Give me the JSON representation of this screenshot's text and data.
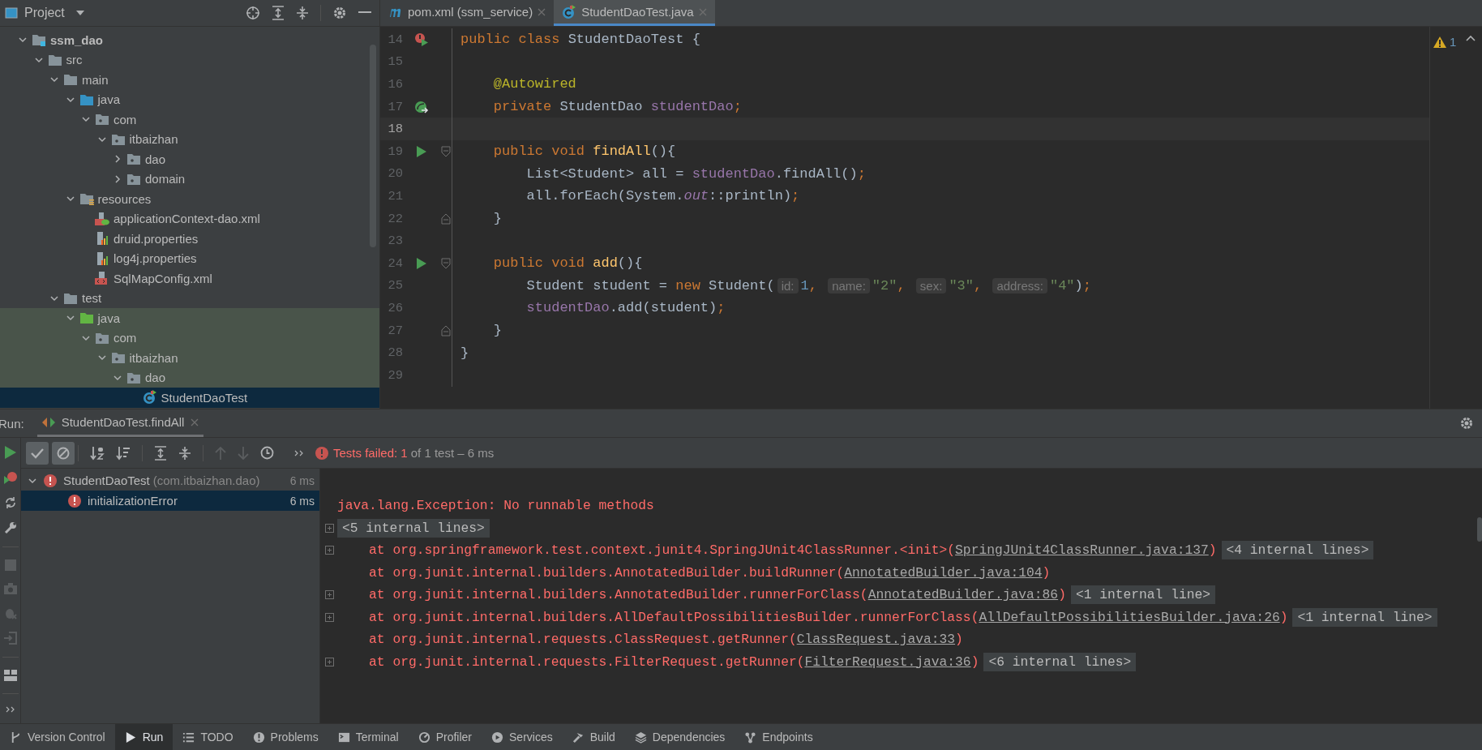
{
  "project": {
    "title": "Project",
    "tree": [
      {
        "label": "ssm_dao",
        "kind": "module",
        "expanded": true,
        "selected": false,
        "children": [
          {
            "label": "src",
            "kind": "folder",
            "expanded": true,
            "selected": false,
            "children": [
              {
                "label": "main",
                "kind": "folder",
                "expanded": true,
                "selected": false,
                "children": [
                  {
                    "label": "java",
                    "kind": "source",
                    "expanded": true,
                    "selected": false,
                    "children": [
                      {
                        "label": "com",
                        "kind": "package",
                        "expanded": true,
                        "selected": false,
                        "children": [
                          {
                            "label": "itbaizhan",
                            "kind": "package",
                            "expanded": true,
                            "selected": false,
                            "children": [
                              {
                                "label": "dao",
                                "kind": "package",
                                "expanded": false,
                                "selected": false
                              },
                              {
                                "label": "domain",
                                "kind": "package",
                                "expanded": false,
                                "selected": false
                              }
                            ]
                          }
                        ]
                      }
                    ]
                  },
                  {
                    "label": "resources",
                    "kind": "resources",
                    "expanded": true,
                    "selected": false,
                    "children": [
                      {
                        "label": "applicationContext-dao.xml",
                        "kind": "spring-xml",
                        "selected": false
                      },
                      {
                        "label": "druid.properties",
                        "kind": "properties",
                        "selected": false
                      },
                      {
                        "label": "log4j.properties",
                        "kind": "properties",
                        "selected": false
                      },
                      {
                        "label": "SqlMapConfig.xml",
                        "kind": "xml",
                        "selected": false
                      }
                    ]
                  }
                ]
              },
              {
                "label": "test",
                "kind": "folder",
                "expanded": true,
                "selected": false,
                "children": [
                  {
                    "label": "java",
                    "kind": "test-source",
                    "expanded": true,
                    "selected": false,
                    "children": [
                      {
                        "label": "com",
                        "kind": "package",
                        "expanded": true,
                        "selected": false,
                        "children": [
                          {
                            "label": "itbaizhan",
                            "kind": "package",
                            "expanded": true,
                            "selected": false,
                            "children": [
                              {
                                "label": "dao",
                                "kind": "package",
                                "expanded": true,
                                "selected": false,
                                "children": [
                                  {
                                    "label": "StudentDaoTest",
                                    "kind": "test-class",
                                    "selected": true
                                  }
                                ]
                              }
                            ]
                          }
                        ]
                      }
                    ]
                  }
                ]
              }
            ]
          }
        ]
      }
    ]
  },
  "editor": {
    "tabs": [
      {
        "label": "pom.xml (ssm_service)",
        "kind": "maven",
        "selected": false
      },
      {
        "label": "StudentDaoTest.java",
        "kind": "test-class",
        "selected": true
      }
    ],
    "warnings": "1",
    "lines": [
      {
        "number": "14",
        "current": false,
        "gutter": [
          {
            "kind": "class-run"
          }
        ],
        "tokens": [
          {
            "kind": "keyword",
            "text": "public class "
          },
          {
            "kind": "plain",
            "text": "StudentDaoTest {"
          }
        ]
      },
      {
        "number": "15",
        "current": false
      },
      {
        "number": "16",
        "current": false,
        "tokens": [
          {
            "kind": "annotation",
            "text": "    @Autowired"
          }
        ]
      },
      {
        "number": "17",
        "current": false,
        "gutter": [
          {
            "kind": "autowired"
          }
        ],
        "tokens": [
          {
            "kind": "keyword",
            "text": "    private "
          },
          {
            "kind": "plain",
            "text": "StudentDao "
          },
          {
            "kind": "field",
            "text": "studentDao"
          },
          {
            "kind": "keyword",
            "text": ";"
          }
        ]
      },
      {
        "number": "18",
        "current": true
      },
      {
        "number": "19",
        "current": false,
        "gutter": [
          {
            "kind": "run"
          },
          {
            "kind": "fold-start"
          }
        ],
        "tokens": [
          {
            "kind": "keyword",
            "text": "    public void "
          },
          {
            "kind": "method",
            "text": "findAll"
          },
          {
            "kind": "plain",
            "text": "(){"
          }
        ]
      },
      {
        "number": "20",
        "current": false,
        "tokens": [
          {
            "kind": "plain",
            "text": "        List<Student> all = "
          },
          {
            "kind": "field",
            "text": "studentDao"
          },
          {
            "kind": "plain",
            "text": ".findAll()"
          },
          {
            "kind": "keyword",
            "text": ";"
          }
        ]
      },
      {
        "number": "21",
        "current": false,
        "tokens": [
          {
            "kind": "plain",
            "text": "        all.forEach(System."
          },
          {
            "kind": "static",
            "text": "out"
          },
          {
            "kind": "plain",
            "text": "::println)"
          },
          {
            "kind": "keyword",
            "text": ";"
          }
        ]
      },
      {
        "number": "22",
        "current": false,
        "gutter": [
          {
            "kind": "fold-end"
          }
        ],
        "tokens": [
          {
            "kind": "plain",
            "text": "    }"
          }
        ]
      },
      {
        "number": "23",
        "current": false
      },
      {
        "number": "24",
        "current": false,
        "gutter": [
          {
            "kind": "run"
          },
          {
            "kind": "fold-start"
          }
        ],
        "tokens": [
          {
            "kind": "keyword",
            "text": "    public void "
          },
          {
            "kind": "method",
            "text": "add"
          },
          {
            "kind": "plain",
            "text": "(){"
          }
        ]
      },
      {
        "number": "25",
        "current": false,
        "tokens": [
          {
            "kind": "plain",
            "text": "        Student student = "
          },
          {
            "kind": "keyword",
            "text": "new "
          },
          {
            "kind": "plain",
            "text": "Student("
          },
          {
            "kind": "hint",
            "text": "id:"
          },
          {
            "kind": "number",
            "text": "1"
          },
          {
            "kind": "keyword",
            "text": ", "
          },
          {
            "kind": "hint",
            "text": "name:"
          },
          {
            "kind": "string",
            "text": "\"2\""
          },
          {
            "kind": "keyword",
            "text": ", "
          },
          {
            "kind": "hint",
            "text": "sex:"
          },
          {
            "kind": "string",
            "text": "\"3\""
          },
          {
            "kind": "keyword",
            "text": ", "
          },
          {
            "kind": "hint",
            "text": "address:"
          },
          {
            "kind": "string",
            "text": "\"4\""
          },
          {
            "kind": "plain",
            "text": ")"
          },
          {
            "kind": "keyword",
            "text": ";"
          }
        ]
      },
      {
        "number": "26",
        "current": false,
        "tokens": [
          {
            "kind": "field",
            "text": "        studentDao"
          },
          {
            "kind": "plain",
            "text": ".add(student)"
          },
          {
            "kind": "keyword",
            "text": ";"
          }
        ]
      },
      {
        "number": "27",
        "current": false,
        "gutter": [
          {
            "kind": "fold-end"
          }
        ],
        "tokens": [
          {
            "kind": "plain",
            "text": "    }"
          }
        ]
      },
      {
        "number": "28",
        "current": false,
        "tokens": [
          {
            "kind": "plain",
            "text": "}"
          }
        ]
      },
      {
        "number": "29",
        "current": false
      }
    ]
  },
  "run": {
    "label": "Run:",
    "tab": "StudentDaoTest.findAll",
    "toggles": [
      {
        "on": true
      },
      {
        "on": true
      }
    ],
    "status": {
      "failed": "Tests failed: 1",
      "detail": "of 1 test – 6 ms"
    },
    "tests": [
      {
        "name": "StudentDaoTest",
        "package": "(com.itbaizhan.dao)",
        "time": "6 ms",
        "selected": false,
        "expanded": true,
        "children": [
          {
            "name": "initializationError",
            "time": "6 ms",
            "selected": true
          }
        ]
      }
    ],
    "console": [
      {
        "kind": "error",
        "expandable": false,
        "text": "java.lang.Exception: No runnable methods"
      },
      {
        "kind": "folded",
        "expandable": true,
        "fold": "<5 internal lines>"
      },
      {
        "kind": "trace",
        "expandable": true,
        "text": "    at org.springframework.test.context.junit4.SpringJUnit4ClassRunner.<init>(",
        "link": "SpringJUnit4ClassRunner.java:137",
        "after": ")",
        "fold": "<4 internal lines>"
      },
      {
        "kind": "trace",
        "expandable": false,
        "text": "    at org.junit.internal.builders.AnnotatedBuilder.buildRunner(",
        "link": "AnnotatedBuilder.java:104",
        "after": ")"
      },
      {
        "kind": "trace",
        "expandable": true,
        "text": "    at org.junit.internal.builders.AnnotatedBuilder.runnerForClass(",
        "link": "AnnotatedBuilder.java:86",
        "after": ")",
        "fold": "<1 internal line>"
      },
      {
        "kind": "trace",
        "expandable": true,
        "text": "    at org.junit.internal.builders.AllDefaultPossibilitiesBuilder.runnerForClass(",
        "link": "AllDefaultPossibilitiesBuilder.java:26",
        "after": ")",
        "fold": "<1 internal line>"
      },
      {
        "kind": "trace",
        "expandable": false,
        "text": "    at org.junit.internal.requests.ClassRequest.getRunner(",
        "link": "ClassRequest.java:33",
        "after": ")"
      },
      {
        "kind": "trace",
        "expandable": true,
        "text": "    at org.junit.internal.requests.FilterRequest.getRunner(",
        "link": "FilterRequest.java:36",
        "after": ")",
        "fold": "<6 internal lines>"
      }
    ]
  },
  "tool_windows": [
    {
      "label": "Version Control",
      "selected": false
    },
    {
      "label": "Run",
      "selected": true
    },
    {
      "label": "TODO",
      "selected": false
    },
    {
      "label": "Problems",
      "selected": false
    },
    {
      "label": "Terminal",
      "selected": false
    },
    {
      "label": "Profiler",
      "selected": false
    },
    {
      "label": "Services",
      "selected": false
    },
    {
      "label": "Build",
      "selected": false
    },
    {
      "label": "Dependencies",
      "selected": false
    },
    {
      "label": "Endpoints",
      "selected": false
    }
  ]
}
